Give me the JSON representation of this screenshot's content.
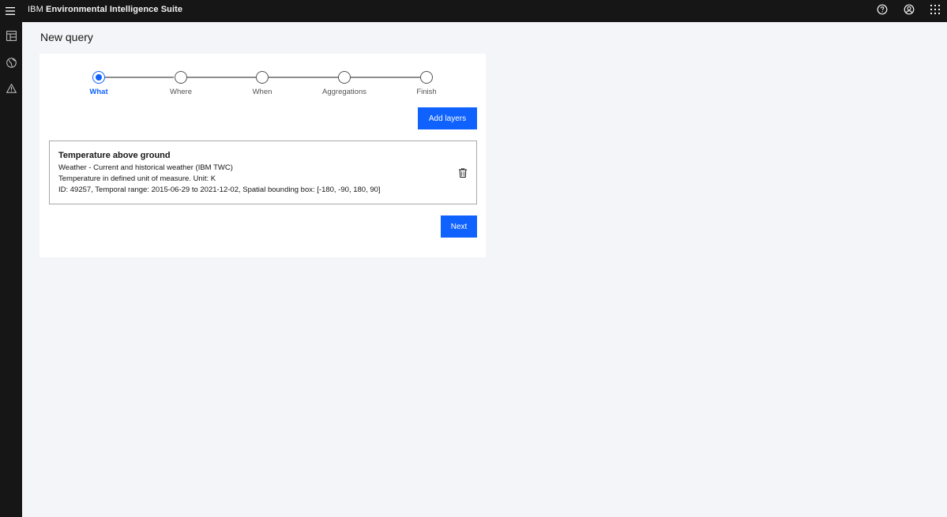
{
  "app": {
    "brand": "IBM",
    "product": "Environmental Intelligence Suite"
  },
  "topbar_icons": [
    "help-icon",
    "user-avatar-icon",
    "app-switcher-icon"
  ],
  "sidenav_icons": [
    "dashboard-icon",
    "globe-icon",
    "warning-icon"
  ],
  "page": {
    "title": "New query"
  },
  "stepper": {
    "steps": [
      {
        "label": "What",
        "state": "current"
      },
      {
        "label": "Where",
        "state": "incomplete"
      },
      {
        "label": "When",
        "state": "incomplete"
      },
      {
        "label": "Aggregations",
        "state": "incomplete"
      },
      {
        "label": "Finish",
        "state": "incomplete"
      }
    ]
  },
  "actions": {
    "add_layers": "Add layers",
    "next": "Next"
  },
  "layer": {
    "name": "Temperature above ground",
    "dataset": "Weather - Current and historical weather (IBM TWC)",
    "description": "Temperature in defined unit of measure. Unit: K",
    "details": "ID: 49257, Temporal range: 2015-06-29 to 2021-12-02, Spatial bounding box: [-180, -90, 180, 90]"
  },
  "colors": {
    "accent": "#0f62fe",
    "shell": "#161616",
    "background": "#f4f5f8"
  }
}
